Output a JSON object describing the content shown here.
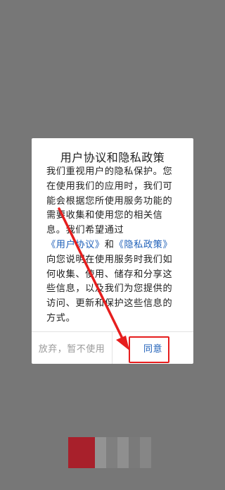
{
  "dialog": {
    "title": "用户协议和隐私政策",
    "body_part1": "我们重视用户的隐私保护。您在使用我们的应用时，我们可能会根据您所使用服务功能的需要收集和使用您的相关信息。我们希望通过",
    "link_user_agreement": "《用户协议》",
    "body_and": "和",
    "link_privacy_policy": "《隐私政策》",
    "body_part2": "向您说明在使用服务时我们如何收集、使用、储存和分享这些信息，以及我们为您提供的访问、更新和保护这些信息的方式。",
    "decline_label": "放弃，暂不使用",
    "agree_label": "同意"
  },
  "colors": {
    "overlay": "#777777",
    "link": "#1e5fb8",
    "annotation_red": "#e61e1e"
  }
}
